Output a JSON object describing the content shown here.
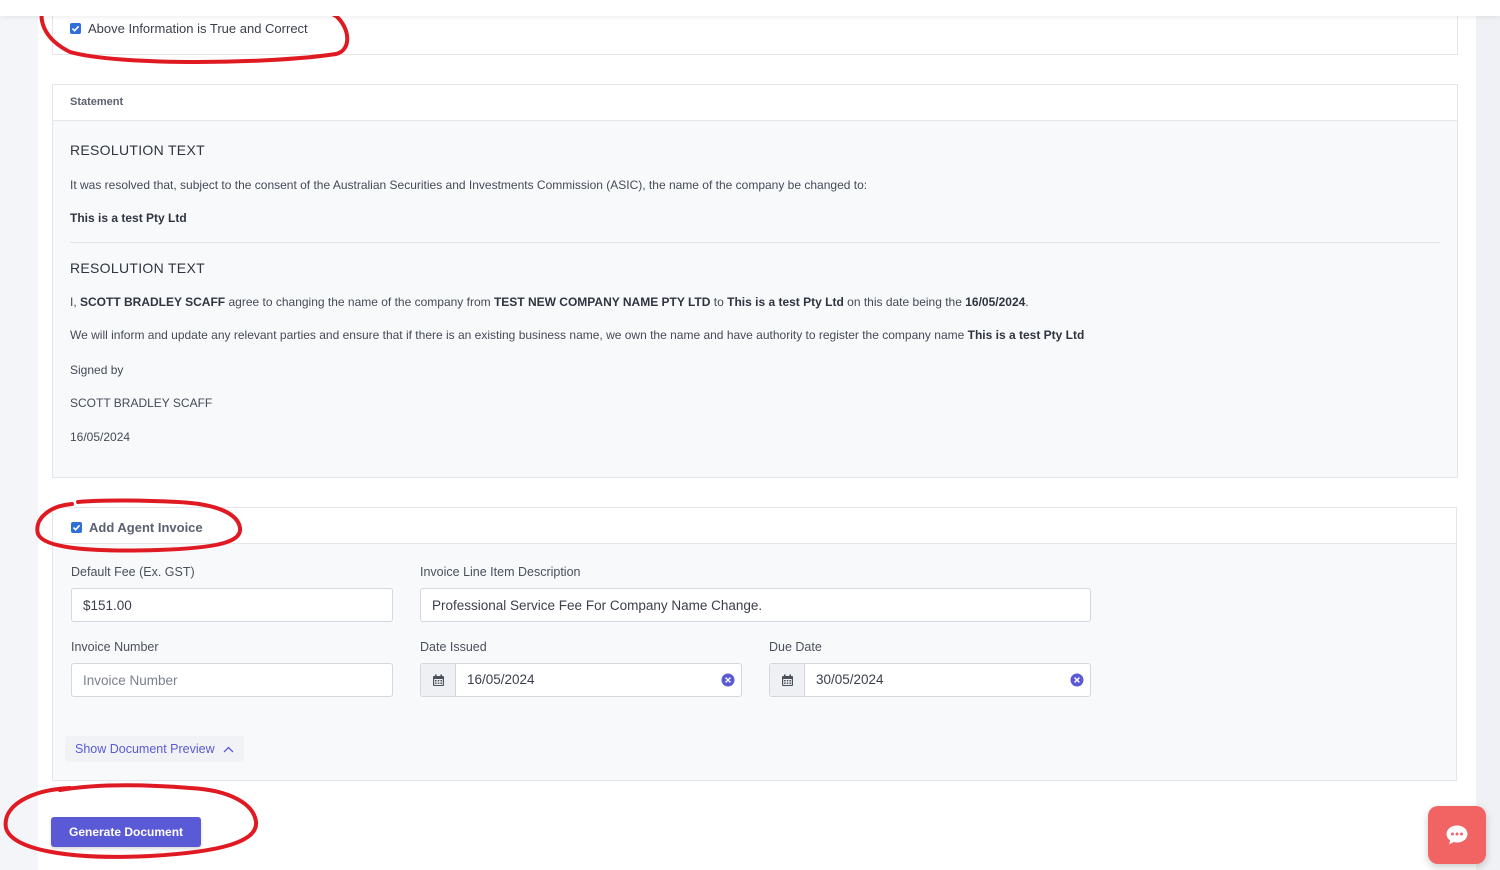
{
  "confirm": {
    "checkbox_label": "Above Information is True and Correct",
    "checked": true
  },
  "statement": {
    "header": "Statement",
    "section1": {
      "title": "RESOLUTION TEXT",
      "text": "It was resolved that, subject to the consent of the Australian Securities and Investments Commission (ASIC), the name of the company be changed to:",
      "new_name": "This is a test Pty Ltd"
    },
    "section2": {
      "title": "RESOLUTION TEXT",
      "p1_prefix": "I, ",
      "signer_bold": "SCOTT BRADLEY SCAFF",
      "p1_mid1": " agree to changing the name of the company from ",
      "old_company": "TEST NEW COMPANY NAME PTY LTD",
      "p1_mid2": " to ",
      "new_company": "This is a test Pty Ltd",
      "p1_mid3": " on this date being the ",
      "date_bold": "16/05/2024",
      "p1_end": ".",
      "p2_text": "We will inform and update any relevant parties and ensure that if there is an existing business name, we own the name and have authority to register the company name ",
      "p2_company": "This is a test Pty Ltd",
      "signed_by_label": "Signed by",
      "signer_name": "SCOTT BRADLEY SCAFF",
      "signed_date": "16/05/2024"
    }
  },
  "invoice": {
    "checkbox_label": "Add Agent Invoice",
    "checked": true,
    "default_fee_label": "Default Fee (Ex. GST)",
    "default_fee_value": "$151.00",
    "line_item_label": "Invoice Line Item Description",
    "line_item_value": "Professional Service Fee For Company Name Change.",
    "invoice_number_label": "Invoice Number",
    "invoice_number_placeholder": "Invoice Number",
    "date_issued_label": "Date Issued",
    "date_issued_value": "16/05/2024",
    "due_date_label": "Due Date",
    "due_date_value": "30/05/2024",
    "show_preview_label": "Show Document Preview"
  },
  "actions": {
    "generate_label": "Generate Document"
  },
  "icons": {
    "calendar": "calendar-icon",
    "clear": "clear-icon",
    "chevron": "chevron-up-icon",
    "chat": "chat-icon"
  },
  "colors": {
    "primary": "#5a5ad6",
    "checkbox": "#2f6fd6",
    "chat": "#f26464",
    "annotation": "#e01a22"
  }
}
